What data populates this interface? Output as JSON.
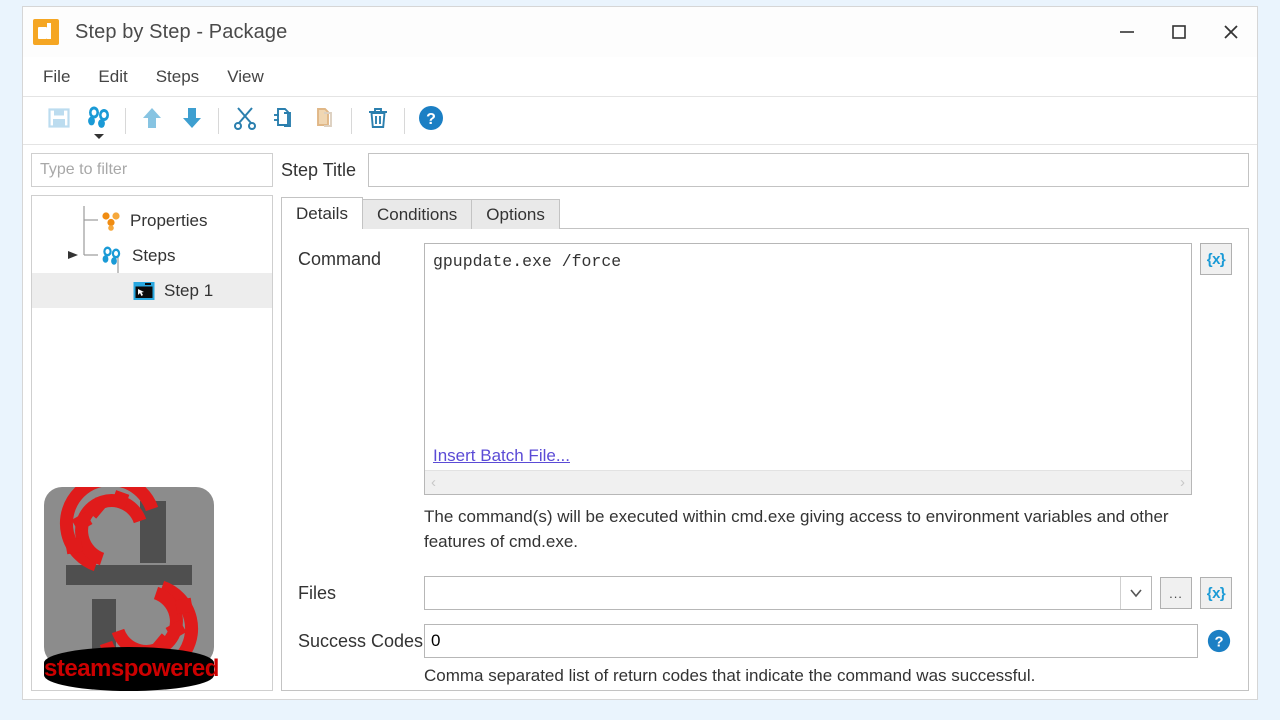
{
  "window": {
    "title": "Step by Step - Package",
    "app_icon": "package-icon",
    "minimize_label": "Minimize",
    "maximize_label": "Maximize",
    "close_label": "Close"
  },
  "menu": {
    "items": [
      {
        "label": "File"
      },
      {
        "label": "Edit"
      },
      {
        "label": "Steps"
      },
      {
        "label": "View"
      }
    ]
  },
  "toolbar": {
    "buttons": [
      {
        "name": "save-button",
        "title": "Save",
        "icon": "save-icon"
      },
      {
        "name": "steps-button",
        "title": "Steps",
        "icon": "footprints-icon"
      },
      {
        "name": "move-up-button",
        "title": "Move Up",
        "icon": "arrow-up-icon"
      },
      {
        "name": "move-down-button",
        "title": "Move Down",
        "icon": "arrow-down-icon"
      },
      {
        "name": "cut-button",
        "title": "Cut",
        "icon": "scissors-icon"
      },
      {
        "name": "copy-button",
        "title": "Copy",
        "icon": "copy-icon"
      },
      {
        "name": "paste-button",
        "title": "Paste",
        "icon": "paste-icon"
      },
      {
        "name": "delete-button",
        "title": "Delete",
        "icon": "trash-icon"
      },
      {
        "name": "help-button",
        "title": "Help",
        "icon": "help-icon"
      }
    ]
  },
  "sidebar": {
    "filter": {
      "placeholder": "Type to filter",
      "value": ""
    },
    "tree": [
      {
        "label": "Properties",
        "icon": "properties-icon",
        "level": 0,
        "selected": false
      },
      {
        "label": "Steps",
        "icon": "footprints-icon",
        "level": 0,
        "selected": false,
        "expanded": true
      },
      {
        "label": "Step 1",
        "icon": "console-icon",
        "level": 1,
        "selected": true
      }
    ]
  },
  "main": {
    "step_title": {
      "label": "Step Title",
      "value": "",
      "placeholder": ""
    },
    "tabs": [
      {
        "label": "Details",
        "active": true
      },
      {
        "label": "Conditions",
        "active": false
      },
      {
        "label": "Options",
        "active": false
      }
    ],
    "details": {
      "command_label": "Command",
      "command_value": "gpupdate.exe /force",
      "insert_batch_link": "Insert Batch File...",
      "command_variable_button": "{x}",
      "command_hint": "The command(s) will be executed within cmd.exe giving access to environment variables and other features of cmd.exe.",
      "files_label": "Files",
      "files_value": "",
      "files_browse_button": "...",
      "files_variable_button": "{x}",
      "success_codes_label": "Success Codes",
      "success_codes_value": "0",
      "success_codes_hint": "Comma separated list of return codes that indicate the command was successful."
    }
  },
  "watermark": {
    "text": "steamspowered"
  },
  "colors": {
    "accent_blue": "#1a9ad6",
    "accent_orange": "#f5a623",
    "link_purple": "#5b4bd6",
    "page_background": "#eaf4fd",
    "selection_grey": "#ededed"
  }
}
